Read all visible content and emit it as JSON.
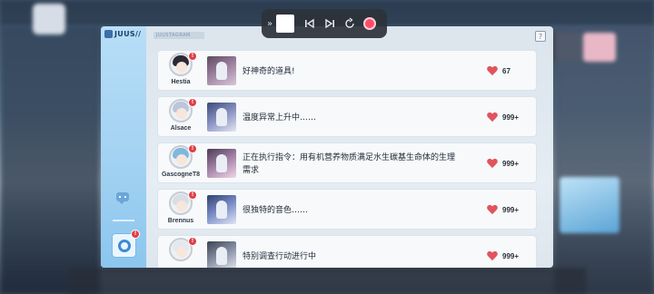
{
  "media_bar": {
    "grip_glyph": "»",
    "icons": [
      "stop-icon",
      "previous-icon",
      "next-icon",
      "replay-icon",
      "record-icon"
    ]
  },
  "juus": {
    "logo_text": "JUUS//",
    "header_tag": "JUUSTAGRAM",
    "help_glyph": "?",
    "camera_badge": "!",
    "accent_color": "#8cc6ee",
    "like_color": "#e0545e",
    "posts": [
      {
        "author": "Hestia",
        "text": "好神奇的道具!",
        "likes": "67",
        "badge": "!",
        "hair": "#2b2a33"
      },
      {
        "author": "Alsace",
        "text": "温度异常上升中……",
        "likes": "999+",
        "badge": "!",
        "hair": "#b9c6dc"
      },
      {
        "author": "GascogneT8",
        "text": "正在执行指令：用有机营养物质满足水生碳基生命体的生理需求",
        "likes": "999+",
        "badge": "!",
        "hair": "#7fb8dd"
      },
      {
        "author": "Brennus",
        "text": "很独特的音色……",
        "likes": "999+",
        "badge": "!",
        "hair": "#d8dde6"
      },
      {
        "author": "",
        "text": "特别调查行动进行中",
        "likes": "999+",
        "badge": "!",
        "hair": "#e5e8ee"
      }
    ]
  }
}
